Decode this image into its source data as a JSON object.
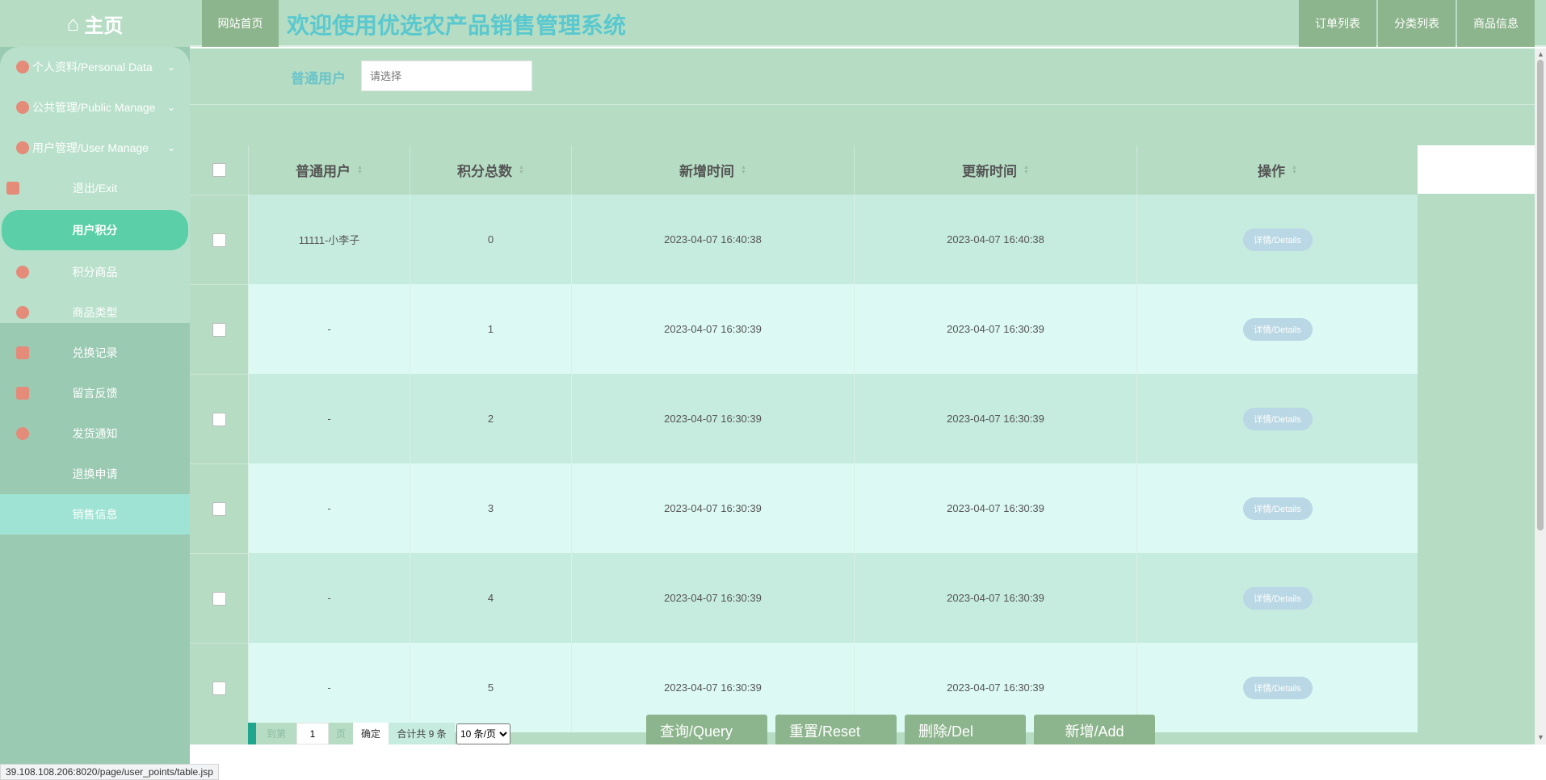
{
  "sidebar": {
    "home_label": "主页",
    "items": [
      {
        "label": "个人资料/Personal Data",
        "chevron": "v"
      },
      {
        "label": "公共管理/Public Manage",
        "chevron": "v"
      },
      {
        "label": "用户管理/User Manage",
        "chevron": "v"
      },
      {
        "label": "退出/Exit"
      },
      {
        "label": "用户积分"
      },
      {
        "label": "积分商品"
      },
      {
        "label": "商品类型"
      },
      {
        "label": "兑换记录"
      },
      {
        "label": "留言反馈"
      },
      {
        "label": "发货通知"
      },
      {
        "label": "退换申请"
      },
      {
        "label": "销售信息"
      }
    ]
  },
  "topbar": {
    "site_home": "网站首页",
    "title": "欢迎使用优选农产品销售管理系统",
    "right": [
      "订单列表",
      "分类列表",
      "商品信息"
    ]
  },
  "search": {
    "label": "普通用户",
    "placeholder": "请选择"
  },
  "table": {
    "headers": [
      "普通用户",
      "积分总数",
      "新增时间",
      "更新时间",
      "操作"
    ],
    "details_label": "详情/Details",
    "rows": [
      {
        "user": "11111-小李子",
        "points": "0",
        "created": "2023-04-07 16:40:38",
        "updated": "2023-04-07 16:40:38"
      },
      {
        "user": "-",
        "points": "1",
        "created": "2023-04-07 16:30:39",
        "updated": "2023-04-07 16:30:39"
      },
      {
        "user": "-",
        "points": "2",
        "created": "2023-04-07 16:30:39",
        "updated": "2023-04-07 16:30:39"
      },
      {
        "user": "-",
        "points": "3",
        "created": "2023-04-07 16:30:39",
        "updated": "2023-04-07 16:30:39"
      },
      {
        "user": "-",
        "points": "4",
        "created": "2023-04-07 16:30:39",
        "updated": "2023-04-07 16:30:39"
      },
      {
        "user": "-",
        "points": "5",
        "created": "2023-04-07 16:30:39",
        "updated": "2023-04-07 16:30:39"
      }
    ]
  },
  "pager": {
    "goto_label": "到第",
    "page_value": "1",
    "page_unit": "页",
    "confirm": "确定",
    "total": "合计共 9 条",
    "page_size": "10 条/页"
  },
  "actions": {
    "query": "查询/Query",
    "reset": "重置/Reset",
    "delete": "删除/Del",
    "add": "新增/Add"
  },
  "status_url": "39.108.108.206:8020/page/user_points/table.jsp"
}
